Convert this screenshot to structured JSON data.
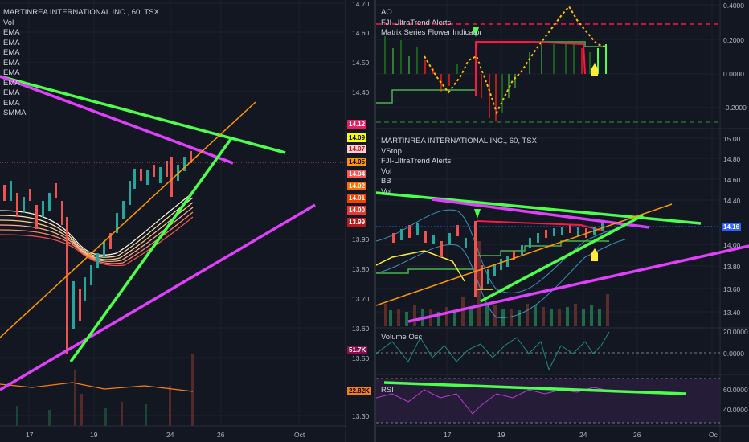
{
  "left_chart": {
    "legend": [
      "MARTINREA INTERNATIONAL INC., 60, TSX",
      "Vol",
      "EMA",
      "EMA",
      "EMA",
      "EMA",
      "EMA",
      "EMA",
      "EMA",
      "EMA",
      "SMMA"
    ],
    "price_axis": [
      "14.70",
      "14.60",
      "14.50",
      "14.40",
      "13.90",
      "13.80",
      "13.70",
      "13.60",
      "13.50",
      "13.30"
    ],
    "price_tags": [
      {
        "text": "14.12",
        "color": "#e91e63"
      },
      {
        "text": "14.09",
        "color": "#f7ff00"
      },
      {
        "text": "14.07",
        "color": "#ffcdd2"
      },
      {
        "text": "14.05",
        "color": "#ff9800"
      },
      {
        "text": "14.04",
        "color": "#ff5252"
      },
      {
        "text": "14.02",
        "color": "#ff6d00"
      },
      {
        "text": "14.01",
        "color": "#ff3d00"
      },
      {
        "text": "14.00",
        "color": "#e53935"
      },
      {
        "text": "13.99",
        "color": "#b71c1c"
      },
      {
        "text": "51.7K",
        "color": "#880e4f"
      },
      {
        "text": "22.82K",
        "color": "#f57f17"
      }
    ],
    "time_axis": [
      "17",
      "19",
      "24",
      "26",
      "Oct"
    ]
  },
  "ao_panel": {
    "legend": [
      "AO",
      "FJI-UltraTrend Alerts",
      "Matrix Series Flower Indicator"
    ],
    "axis": [
      "0.4000",
      "0.2000",
      "0.0000",
      "-0.2000"
    ]
  },
  "main_panel": {
    "legend": [
      "MARTINREA INTERNATIONAL INC., 60, TSX",
      "VStop",
      "FJI-UltraTrend Alerts",
      "Vol",
      "BB",
      "Vol"
    ],
    "axis": [
      "15.00",
      "14.80",
      "14.60",
      "14.40",
      "14.00",
      "13.80",
      "13.60",
      "13.40"
    ],
    "price_tag": {
      "text": "14.16",
      "color": "#2962ff"
    }
  },
  "volosc_panel": {
    "legend": [
      "Volume Osc"
    ],
    "axis": [
      "20.0000",
      "0.0000"
    ]
  },
  "rsi_panel": {
    "legend": [
      "RSI"
    ],
    "axis": [
      "60.0000",
      "40.0000"
    ]
  },
  "right_time_axis": [
    "17",
    "19",
    "24",
    "26",
    "Oc"
  ]
}
